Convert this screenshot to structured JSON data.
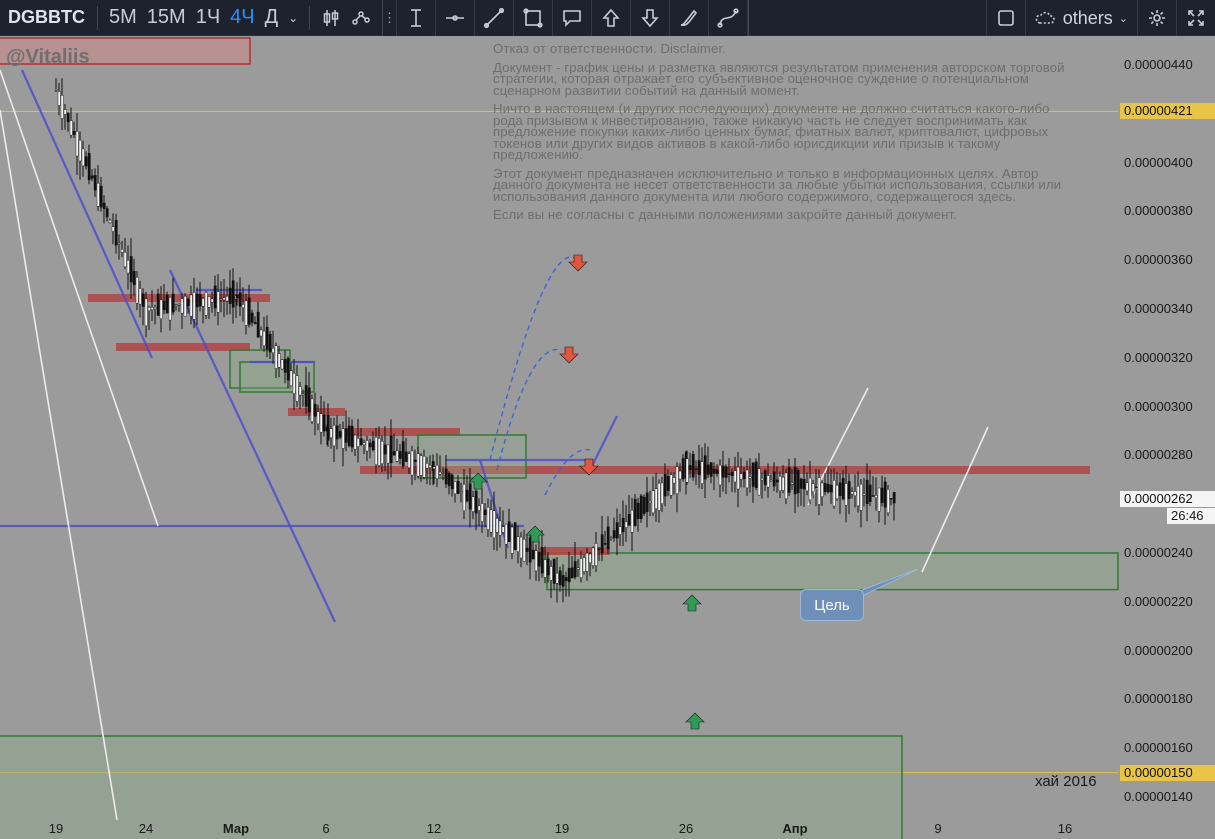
{
  "toolbar": {
    "symbol": "DGBBTC",
    "intervals": [
      "5M",
      "15M",
      "1Ч",
      "4Ч",
      "Д"
    ],
    "active_interval": "4Ч",
    "others_label": "others"
  },
  "watermark": "@Vitaliis",
  "disclaimer": [
    "Отказ от ответственности. Disclaimer.",
    "Документ - график цены и разметка являются результатом применения авторском торговой стратегии, которая отражает его субъективное оценочное суждение о потенциальном сценарном развитии событий на данный момент.",
    "Ничто в настоящем (и других последующих) документе не должно считаться какого-либо рода призывом к инвестированию, также никакую часть не следует воспринимать как предложение покупки каких-либо ценных бумаг, фиатных валют, криптовалют, цифровых токенов или других видов активов в какой-либо юрисдикции или призыв к такому предложению.",
    "Этот документ предназначен исключительно и только в информационных целях. Автор данного документа не несет ответственности за любые убытки использования, ссылки или использования данного документа или любого содержимого, содержащегося здесь.",
    "Если вы не согласны с данными положениями закройте данный документ."
  ],
  "annotations": {
    "target": "Цель",
    "hai": "хай 2016"
  },
  "chart_data": {
    "type": "line",
    "title": "",
    "price_axis": [
      "0.00000440",
      "0.00000400",
      "0.00000380",
      "0.00000360",
      "0.00000340",
      "0.00000320",
      "0.00000300",
      "0.00000280",
      "0.00000240",
      "0.00000220",
      "0.00000200",
      "0.00000180",
      "0.00000160",
      "0.00000140"
    ],
    "highlighted_prices": [
      "0.00000421",
      "0.00000262",
      "0.00000150"
    ],
    "countdown": "26:46",
    "x_labels": [
      "19",
      "24",
      "Мар",
      "6",
      "12",
      "19",
      "26",
      "Апр",
      "9",
      "16"
    ],
    "ylim": [
      1.35e-06,
      4.45e-06
    ],
    "x": [
      "19",
      "24",
      "Мар",
      "6",
      "12",
      "19",
      "26",
      "Апр"
    ],
    "series": [
      {
        "values": [
          4.3e-06,
          3.4e-06,
          3.45e-06,
          2.9e-06,
          2.75e-06,
          2.28e-06,
          2.75e-06,
          2.62e-06
        ]
      }
    ],
    "levels": {
      "resistance": [
        2.74e-06,
        4.42e-06
      ],
      "support_zone": [
        2.25e-06,
        2.4e-06
      ],
      "low_zone": [
        1.35e-06,
        1.65e-06
      ]
    },
    "colors": {
      "background": "#9b9b9b",
      "resistance": "#b04545",
      "support": "#2f7a2f",
      "trend": "#4c4ccf",
      "highlight_line": "#e8c547"
    }
  }
}
